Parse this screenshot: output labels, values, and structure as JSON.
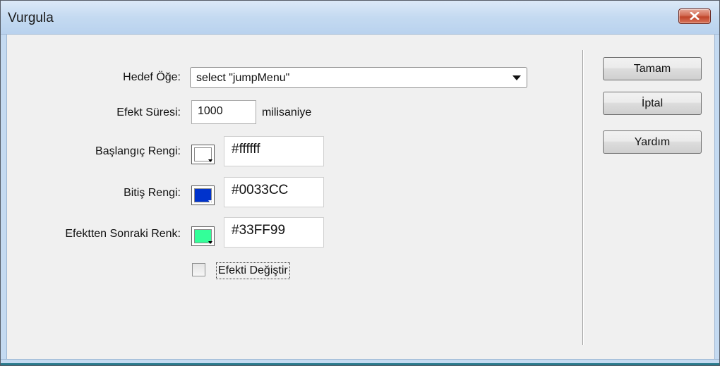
{
  "window": {
    "title": "Vurgula"
  },
  "form": {
    "target_label": "Hedef Öğe:",
    "target_value": "select \"jumpMenu\"",
    "duration_label": "Efekt Süresi:",
    "duration_value": "1000",
    "duration_unit": "milisaniye",
    "start_color_label": "Başlangıç Rengi:",
    "start_color_value": "#ffffff",
    "end_color_label": "Bitiş Rengi:",
    "end_color_value": "#0033CC",
    "after_color_label": "Efektten Sonraki Renk:",
    "after_color_value": "#33FF99",
    "toggle_label": "Efekti Değiştir",
    "toggle_checked": false
  },
  "buttons": {
    "ok": "Tamam",
    "cancel": "İptal",
    "help": "Yardım"
  },
  "colors": {
    "start_swatch": "#ffffff",
    "end_swatch": "#0033cc",
    "after_swatch": "#33ff99",
    "close_button": "#c7432a"
  },
  "icons": {
    "close": "close-icon",
    "dropdown": "chevron-down-icon"
  }
}
